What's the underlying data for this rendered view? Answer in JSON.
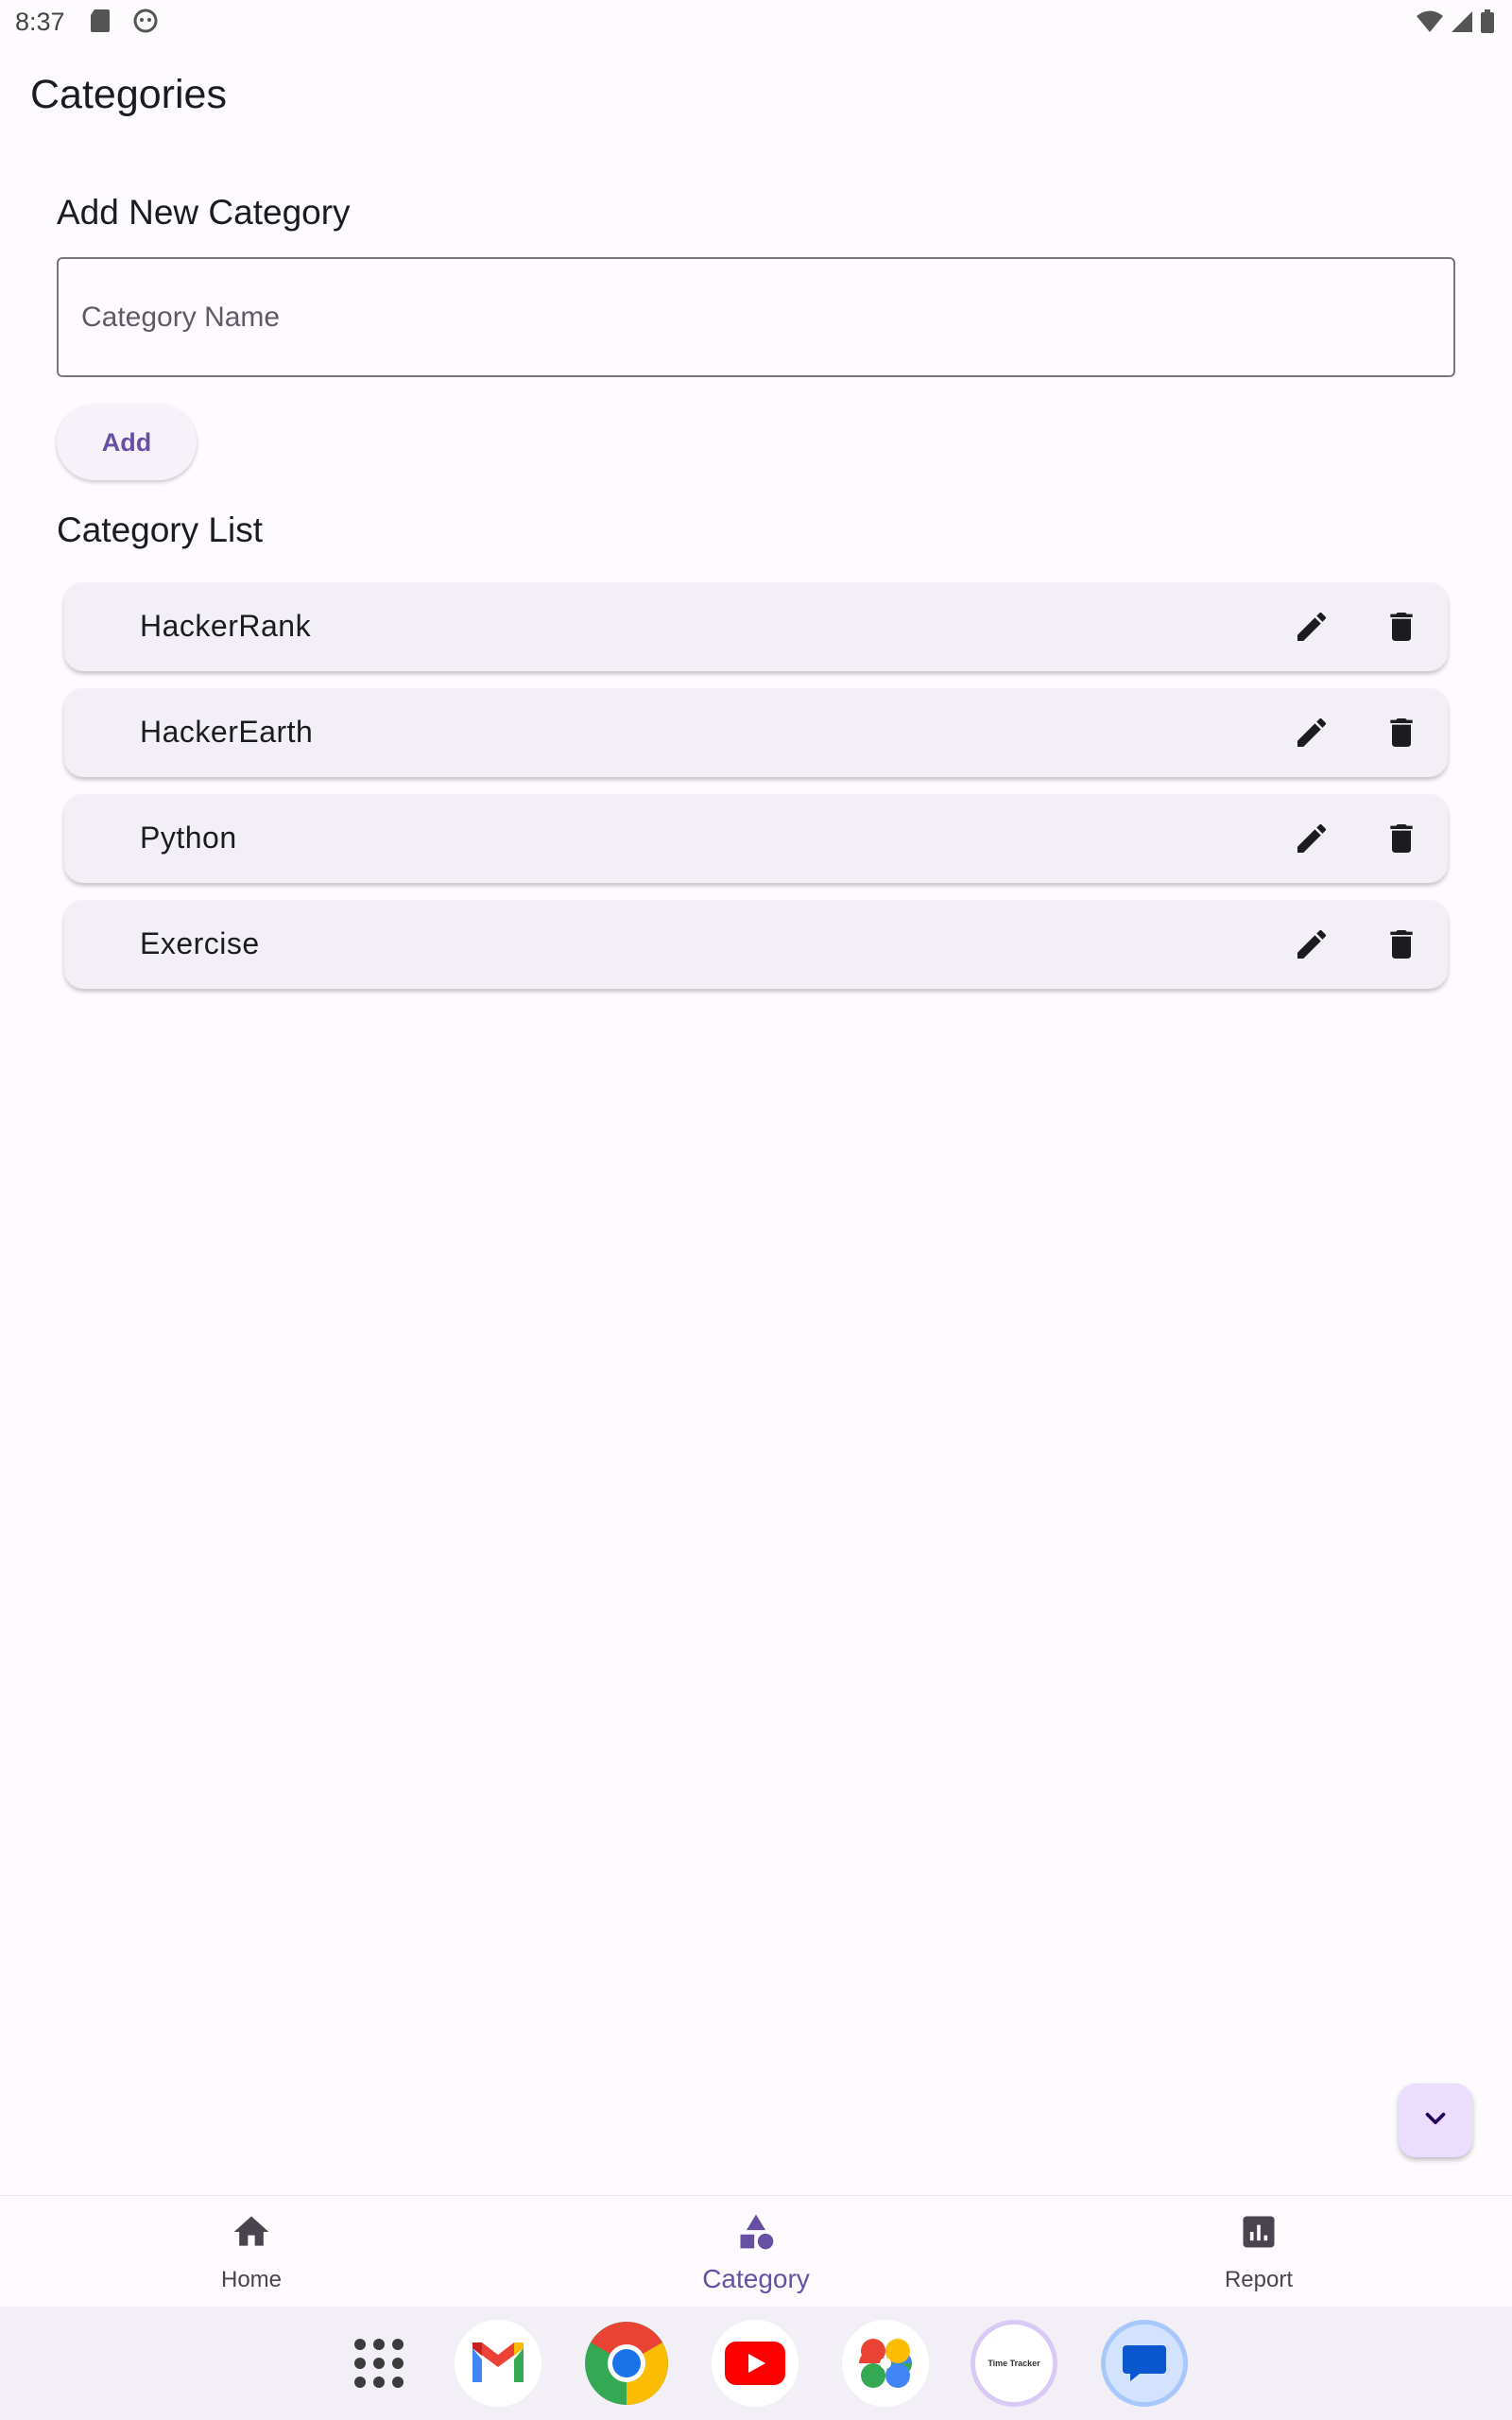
{
  "status_bar": {
    "time": "8:37"
  },
  "app": {
    "title": "Categories"
  },
  "add_section": {
    "heading": "Add New Category",
    "input_placeholder": "Category Name",
    "input_value": "",
    "add_button_label": "Add"
  },
  "list_section": {
    "heading": "Category List",
    "items": [
      {
        "name": "HackerRank"
      },
      {
        "name": "HackerEarth"
      },
      {
        "name": "Python"
      },
      {
        "name": "Exercise"
      }
    ]
  },
  "bottom_nav": {
    "items": [
      {
        "label": "Home",
        "icon": "home-icon",
        "active": false
      },
      {
        "label": "Category",
        "icon": "category-icon",
        "active": true
      },
      {
        "label": "Report",
        "icon": "report-icon",
        "active": false
      }
    ]
  },
  "dock": {
    "apps": [
      "app-drawer-icon",
      "gmail-icon",
      "chrome-icon",
      "youtube-icon",
      "photos-icon",
      "time-tracker-icon",
      "messages-icon"
    ],
    "time_tracker_label": "Time Tracker"
  },
  "colors": {
    "accent": "#6750a4",
    "background": "#fefbff",
    "card": "#f3eff7"
  }
}
